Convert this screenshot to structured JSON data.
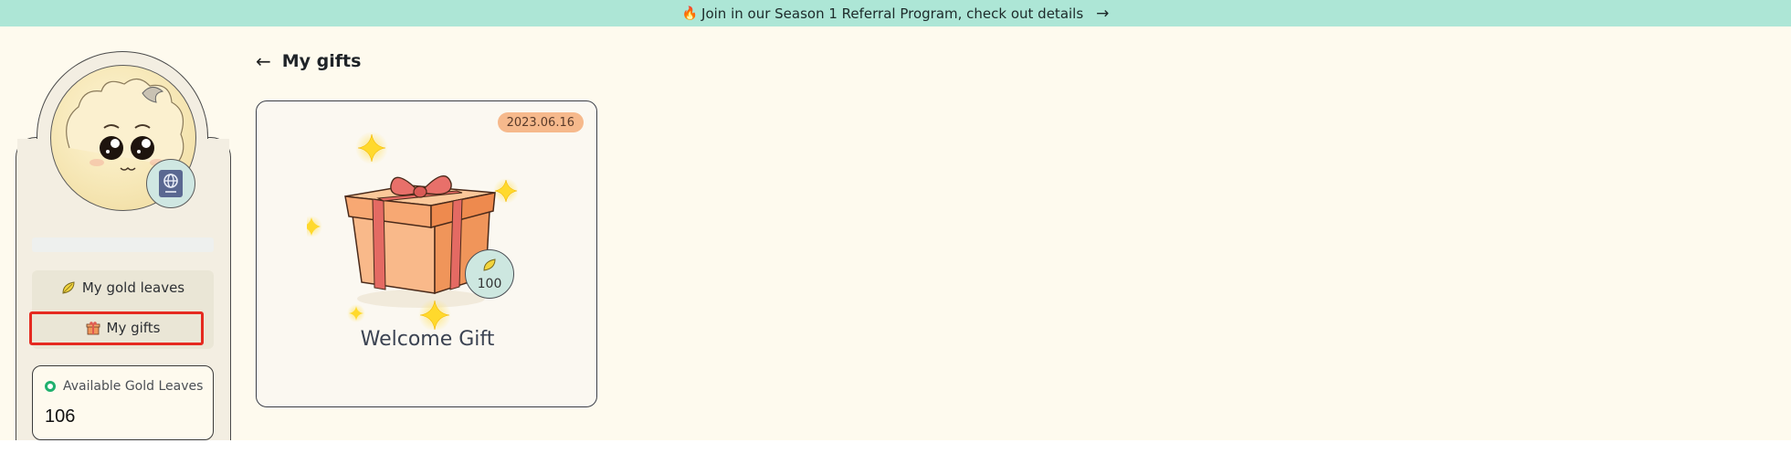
{
  "banner": {
    "icon": "fire-icon",
    "text": "Join in our Season 1 Referral Program, check out details",
    "arrow": "→"
  },
  "sidebar": {
    "menu": [
      {
        "label": "My gold leaves",
        "icon": "gold-leaf-icon"
      },
      {
        "label": "My gifts",
        "icon": "gift-box-icon",
        "selected": true
      }
    ],
    "available": {
      "label": "Available Gold Leaves",
      "value": "106"
    }
  },
  "main": {
    "back_arrow": "←",
    "title": "My gifts",
    "gifts": [
      {
        "date": "2023.06.16",
        "name": "Welcome Gift",
        "leaves": "100"
      }
    ]
  },
  "colors": {
    "banner_bg": "#ade6d6",
    "page_bg": "#fefaee",
    "highlight": "#e52a20",
    "date_badge": "#f6b98c"
  }
}
